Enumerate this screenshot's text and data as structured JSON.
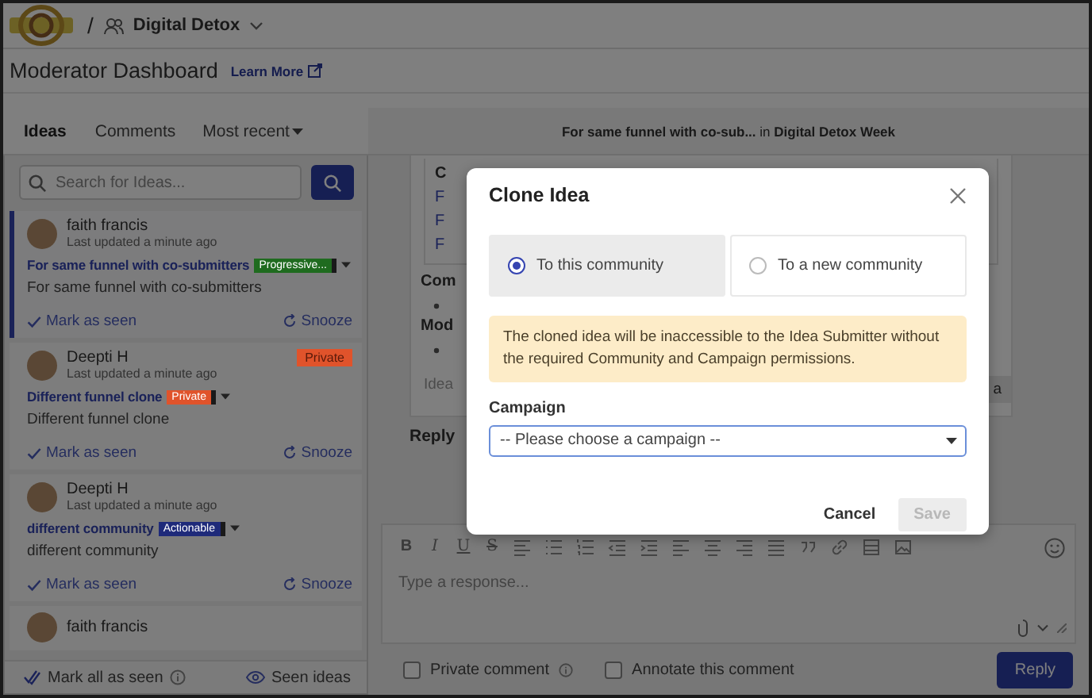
{
  "header": {
    "separator": "/",
    "community": "Digital Detox"
  },
  "page": {
    "title": "Moderator Dashboard",
    "learn_more": "Learn More"
  },
  "tabs": [
    {
      "label": "Ideas",
      "selected": true
    },
    {
      "label": "Comments",
      "selected": false
    }
  ],
  "sort": {
    "label": "Most recent"
  },
  "breadcrumb": "**For same funnel with co-sub...** in **Digital Detox Week**",
  "search": {
    "placeholder": "Search for Ideas..."
  },
  "ideas": [
    {
      "author": "faith francis",
      "updated": "Last updated a minute ago",
      "title": "For same funnel with co-submitters",
      "badge": {
        "label": "Progressive...",
        "color": "#1f6b1f"
      },
      "description": "For same funnel with co-submitters",
      "mark_seen": "Mark as seen",
      "snooze": "Snooze",
      "selected": true
    },
    {
      "author": "Deepti H",
      "updated": "Last updated a minute ago",
      "corner_badge": {
        "label": "Private",
        "color": "#e0532b"
      },
      "title": "Different funnel clone",
      "badge": {
        "label": "Private",
        "color": "#e0532b"
      },
      "description": "Different funnel clone",
      "mark_seen": "Mark as seen",
      "snooze": "Snooze",
      "selected": false
    },
    {
      "author": "Deepti H",
      "updated": "Last updated a minute ago",
      "title": "different community",
      "badge": {
        "label": "Actionable",
        "color": "#1e2a7a"
      },
      "description": "different community",
      "mark_seen": "Mark as seen",
      "snooze": "Snooze",
      "selected": false
    },
    {
      "author": "faith francis",
      "selected": false
    }
  ],
  "list_footer": {
    "mark_all": "Mark all as seen",
    "seen_ideas": "Seen ideas"
  },
  "detail": {
    "box_heading": "C",
    "box_links": [
      "F",
      "F",
      "F"
    ],
    "sections": [
      {
        "heading": "Com"
      },
      {
        "heading": "Mod"
      }
    ],
    "ideas_label": "Idea",
    "button_fragment": "a",
    "reply_heading": "Reply"
  },
  "editor": {
    "format_buttons": [
      {
        "label": "B",
        "kind": "bold"
      },
      {
        "label": "I",
        "kind": "italic"
      },
      {
        "label": "U",
        "kind": "underline"
      },
      {
        "label": "S",
        "kind": "strike"
      }
    ],
    "placeholder": "Type a response...",
    "options": [
      {
        "label": "Private comment",
        "checked": false,
        "info": true
      },
      {
        "label": "Annotate this comment",
        "checked": false,
        "info": false
      }
    ],
    "submit": "Reply"
  },
  "modal": {
    "title": "Clone Idea",
    "targets": [
      {
        "label": "To this community",
        "selected": true
      },
      {
        "label": "To a new community",
        "selected": false
      }
    ],
    "warning": "The cloned idea will be inaccessible to the Idea Submitter without the required Community and Campaign permissions.",
    "field_label": "Campaign",
    "select": {
      "value": "-- Please choose a campaign --"
    },
    "actions": [
      {
        "label": "Cancel",
        "kind": "text",
        "disabled": false
      },
      {
        "label": "Save",
        "kind": "primary",
        "disabled": true
      }
    ]
  }
}
